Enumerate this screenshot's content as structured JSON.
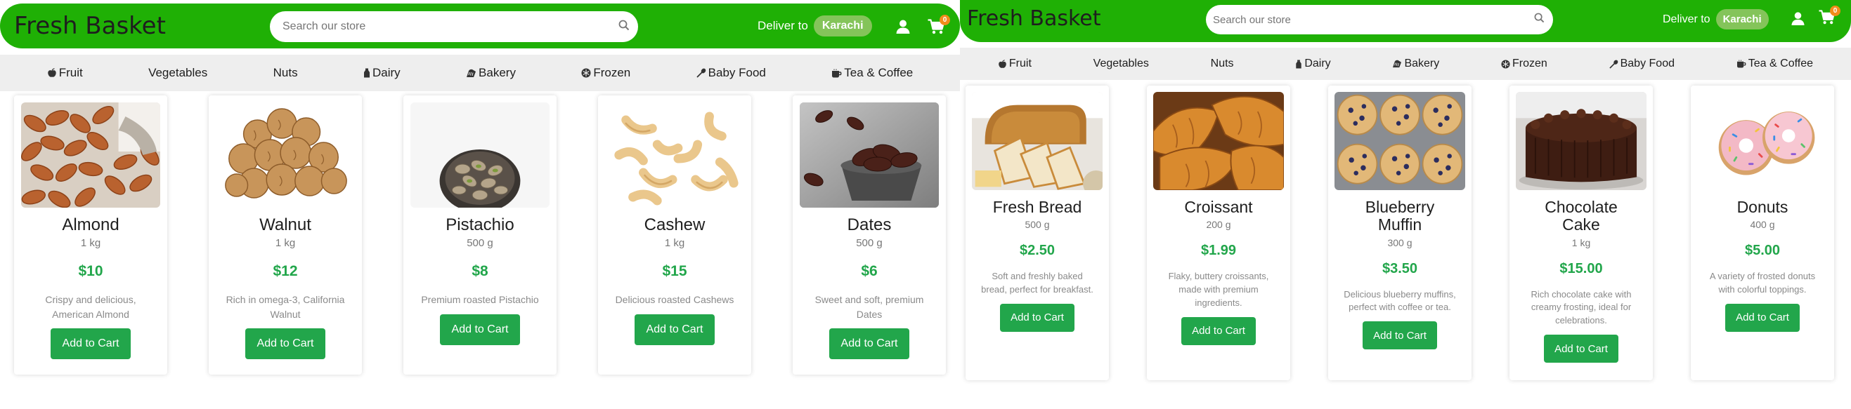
{
  "left": {
    "header": {
      "logo": "Fresh Basket",
      "search_placeholder": "Search our store",
      "deliver_label": "Deliver to",
      "city": "Karachi",
      "cart_count": "0"
    },
    "categories": [
      {
        "label": "Fruit",
        "icon": "apple-icon"
      },
      {
        "label": "Vegetables",
        "icon": ""
      },
      {
        "label": "Nuts",
        "icon": ""
      },
      {
        "label": "Dairy",
        "icon": "milk-bottle-icon"
      },
      {
        "label": "Bakery",
        "icon": "bread-icon"
      },
      {
        "label": "Frozen",
        "icon": "snowflake-icon"
      },
      {
        "label": "Baby Food",
        "icon": "spoon-icon"
      },
      {
        "label": "Tea & Coffee",
        "icon": "mug-icon"
      }
    ],
    "products": [
      {
        "name": "Almond",
        "qty": "1 kg",
        "price": "$10",
        "desc": "Crispy and delicious, American Almond",
        "button": "Add to Cart",
        "image": "almonds"
      },
      {
        "name": "Walnut",
        "qty": "1 kg",
        "price": "$12",
        "desc": "Rich in omega-3, California Walnut",
        "button": "Add to Cart",
        "image": "walnuts"
      },
      {
        "name": "Pistachio",
        "qty": "500 g",
        "price": "$8",
        "desc": "Premium roasted Pistachio",
        "button": "Add to Cart",
        "image": "pistachios"
      },
      {
        "name": "Cashew",
        "qty": "1 kg",
        "price": "$15",
        "desc": "Delicious roasted Cashews",
        "button": "Add to Cart",
        "image": "cashews"
      },
      {
        "name": "Dates",
        "qty": "500 g",
        "price": "$6",
        "desc": "Sweet and soft, premium Dates",
        "button": "Add to Cart",
        "image": "dates"
      }
    ]
  },
  "right": {
    "header": {
      "logo": "Fresh Basket",
      "search_placeholder": "Search our store",
      "deliver_label": "Deliver to",
      "city": "Karachi",
      "cart_count": "0"
    },
    "categories": [
      {
        "label": "Fruit",
        "icon": "apple-icon"
      },
      {
        "label": "Vegetables",
        "icon": ""
      },
      {
        "label": "Nuts",
        "icon": ""
      },
      {
        "label": "Dairy",
        "icon": "milk-bottle-icon"
      },
      {
        "label": "Bakery",
        "icon": "bread-icon"
      },
      {
        "label": "Frozen",
        "icon": "snowflake-icon"
      },
      {
        "label": "Baby Food",
        "icon": "spoon-icon"
      },
      {
        "label": "Tea & Coffee",
        "icon": "mug-icon"
      }
    ],
    "products": [
      {
        "name": "Fresh Bread",
        "qty": "500 g",
        "price": "$2.50",
        "desc": "Soft and freshly baked bread, perfect for breakfast.",
        "button": "Add to Cart",
        "image": "bread"
      },
      {
        "name": "Croissant",
        "qty": "200 g",
        "price": "$1.99",
        "desc": "Flaky, buttery croissants, made with premium ingredients.",
        "button": "Add to Cart",
        "image": "croissants"
      },
      {
        "name": "Blueberry Muffin",
        "qty": "300 g",
        "price": "$3.50",
        "desc": "Delicious blueberry muffins, perfect with coffee or tea.",
        "button": "Add to Cart",
        "image": "muffins"
      },
      {
        "name": "Chocolate Cake",
        "qty": "1 kg",
        "price": "$15.00",
        "desc": "Rich chocolate cake with creamy frosting, ideal for celebrations.",
        "button": "Add to Cart",
        "image": "cake"
      },
      {
        "name": "Donuts",
        "qty": "400 g",
        "price": "$5.00",
        "desc": "A variety of frosted donuts with colorful toppings.",
        "button": "Add to Cart",
        "image": "donuts"
      }
    ]
  },
  "colors": {
    "header_green": "#1fb005",
    "price_green": "#22a64b",
    "button_green": "#22a64b",
    "city_pill": "#84c45a",
    "cart_badge": "#f28c1b",
    "nav_bg": "#eeeeee"
  }
}
